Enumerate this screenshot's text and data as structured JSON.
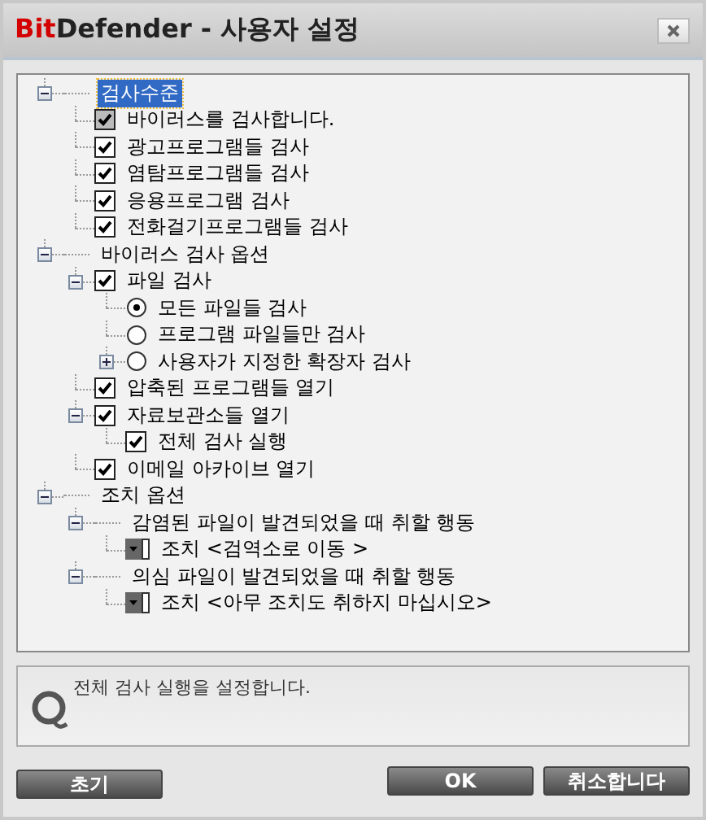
{
  "window": {
    "title_brand": "Bit",
    "title_rest": "Defender - 사용자 설정"
  },
  "tree": [
    {
      "kind": "group",
      "label": "검사수준",
      "selected": true,
      "expanded": true,
      "children": [
        {
          "kind": "check",
          "label": "바이러스를 검사합니다.",
          "checked": true,
          "disabled": true,
          "selected": false
        },
        {
          "kind": "check",
          "label": "광고프로그램들 검사",
          "checked": true,
          "disabled": false,
          "selected": false
        },
        {
          "kind": "check",
          "label": "염탐프로그램들 검사",
          "checked": true,
          "disabled": false,
          "selected": false
        },
        {
          "kind": "check",
          "label": "응용프로그램 검사",
          "checked": true,
          "disabled": false,
          "selected": false
        },
        {
          "kind": "check",
          "label": "전화걸기프로그램들 검사",
          "checked": true,
          "disabled": false,
          "selected": false
        }
      ]
    },
    {
      "kind": "group",
      "label": "바이러스 검사 옵션",
      "selected": false,
      "expanded": true,
      "children": [
        {
          "kind": "check",
          "label": "파일 검사",
          "checked": true,
          "disabled": false,
          "selected": false,
          "expanded": true,
          "children": [
            {
              "kind": "radio",
              "label": "모든 파일들 검사",
              "checked": true,
              "selected": false
            },
            {
              "kind": "radio",
              "label": "프로그램 파일들만 검사",
              "checked": false,
              "selected": false
            },
            {
              "kind": "radio",
              "label": "사용자가 지정한 확장자 검사",
              "checked": false,
              "selected": false,
              "expanded": false
            }
          ]
        },
        {
          "kind": "check",
          "label": "압축된 프로그램들 열기",
          "checked": true,
          "disabled": false,
          "selected": false
        },
        {
          "kind": "check",
          "label": "자료보관소들 열기",
          "checked": true,
          "disabled": false,
          "selected": false,
          "expanded": true,
          "children": [
            {
              "kind": "check",
              "label": "전체 검사 실행",
              "checked": true,
              "disabled": false,
              "selected": false
            }
          ]
        },
        {
          "kind": "check",
          "label": "이메일 아카이브 열기",
          "checked": true,
          "disabled": false,
          "selected": false
        }
      ]
    },
    {
      "kind": "group",
      "label": "조치 옵션",
      "selected": false,
      "expanded": true,
      "children": [
        {
          "kind": "group",
          "label": "감염된 파일이 발견되었을 때 취할 행동",
          "selected": false,
          "expanded": true,
          "children": [
            {
              "kind": "dropdown",
              "label": "조치 <검역소로 이동 >",
              "selected": false
            }
          ]
        },
        {
          "kind": "group",
          "label": "의심 파일이 발견되었을 때 취할 행동",
          "selected": false,
          "expanded": true,
          "children": [
            {
              "kind": "dropdown",
              "label": "조치 <아무 조치도 취하지 마십시오>",
              "selected": false
            }
          ]
        }
      ]
    }
  ],
  "info": "전체 검사 실행을 설정합니다.",
  "buttons": {
    "left": [
      "초기"
    ],
    "right": [
      "OK",
      "취소합니다"
    ]
  }
}
